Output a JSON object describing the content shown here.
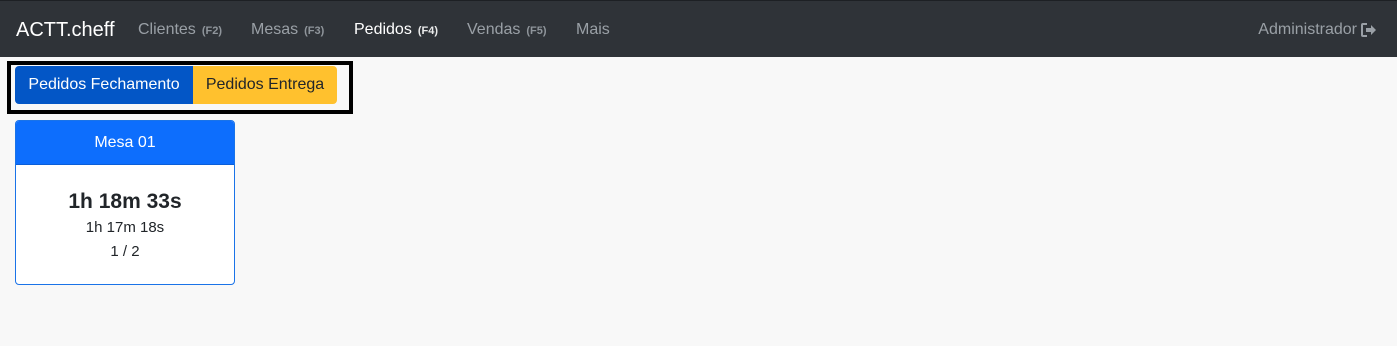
{
  "navbar": {
    "brand": "ACTT.cheff",
    "items": [
      {
        "label": "Clientes",
        "key": "(F2)"
      },
      {
        "label": "Mesas",
        "key": "(F3)"
      },
      {
        "label": "Pedidos",
        "key": "(F4)"
      },
      {
        "label": "Vendas",
        "key": "(F5)"
      },
      {
        "label": "Mais",
        "key": ""
      }
    ],
    "user": "Administrador",
    "user_icon": "sign-out-icon"
  },
  "toolbar": {
    "closing_label": "Pedidos Fechamento",
    "delivery_label": "Pedidos Entrega"
  },
  "tables": [
    {
      "title": "Mesa 01",
      "elapsed": "1h 18m 33s",
      "secondary": "1h 17m 18s",
      "ratio": "1 / 2"
    }
  ],
  "colors": {
    "navbar_bg": "#2f3338",
    "primary": "#0356c6",
    "warning": "#ffc12e",
    "card_header": "#0d6efd"
  }
}
